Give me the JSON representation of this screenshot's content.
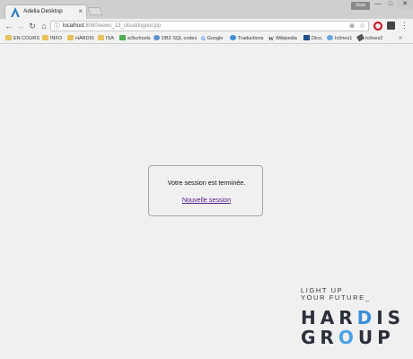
{
  "browser": {
    "tab_title": "Adelia Desktop",
    "tab_close": "×",
    "user_badge": "Zeus",
    "window_controls": {
      "minimize": "—",
      "maximize": "□",
      "close": "✕"
    }
  },
  "toolbar": {
    "back": "←",
    "forward": "→",
    "reload": "↻",
    "home": "⌂",
    "url_host": "localhost",
    "url_path": ":8080/eews_13_cloud/logout.jsp",
    "menu": "⋮"
  },
  "bookmarks": [
    {
      "label": "EN COURS",
      "icon": "folder-icon"
    },
    {
      "label": "INFO",
      "icon": "folder-icon"
    },
    {
      "label": "HARDIS",
      "icon": "folder-icon"
    },
    {
      "label": "ISA",
      "icon": "folder-icon"
    },
    {
      "label": "w3schools",
      "icon": "w3schools-icon"
    },
    {
      "label": "DB2 SQL codes",
      "icon": "db2-icon"
    },
    {
      "label": "Google",
      "icon": "google-icon"
    },
    {
      "label": "Traductions",
      "icon": "translate-icon"
    },
    {
      "label": "Wikipedia",
      "icon": "wikipedia-icon"
    },
    {
      "label": "Dico.",
      "icon": "dico-icon"
    },
    {
      "label": "Icônes1",
      "icon": "icons-icon"
    },
    {
      "label": "Icônes2",
      "icon": "icons-icon"
    }
  ],
  "bookmarks_more": "»",
  "dialog": {
    "message": "Votre session est terminée.",
    "link": "Nouvelle session"
  },
  "logo": {
    "tagline_1": "LIGHT UP",
    "tagline_2": "YOUR FUTURE_",
    "word1_a": "HAR",
    "word1_b": "D",
    "word1_c": "IS",
    "word2_a": "GR",
    "word2_b": "O",
    "word2_c": "UP"
  },
  "colors": {
    "link": "#551a8b",
    "logo_accent": "#3a8fd6"
  }
}
